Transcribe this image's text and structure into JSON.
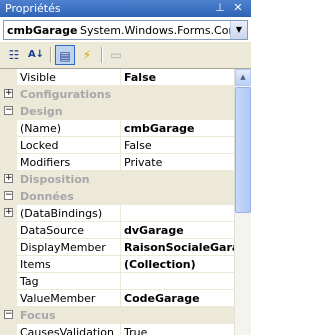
{
  "window": {
    "title": "Propriétés"
  },
  "object_selector": {
    "name": "cmbGarage",
    "type": "System.Windows.Forms.ComboBox"
  },
  "properties": [
    {
      "kind": "prop",
      "name": "Visible",
      "value": "False",
      "bold": true
    },
    {
      "kind": "cat",
      "name": "Configurations",
      "expander": "+"
    },
    {
      "kind": "cat",
      "name": "Design",
      "expander": "−"
    },
    {
      "kind": "prop",
      "name": "(Name)",
      "value": "cmbGarage",
      "bold": true
    },
    {
      "kind": "prop",
      "name": "Locked",
      "value": "False",
      "bold": false
    },
    {
      "kind": "prop",
      "name": "Modifiers",
      "value": "Private",
      "bold": false
    },
    {
      "kind": "cat",
      "name": "Disposition",
      "expander": "+"
    },
    {
      "kind": "cat",
      "name": "Données",
      "expander": "−"
    },
    {
      "kind": "prop",
      "name": "(DataBindings)",
      "value": "",
      "bold": false,
      "expander": "+"
    },
    {
      "kind": "prop",
      "name": "DataSource",
      "value": "dvGarage",
      "bold": true
    },
    {
      "kind": "prop",
      "name": "DisplayMember",
      "value": "RaisonSocialeGarage",
      "bold": true
    },
    {
      "kind": "prop",
      "name": "Items",
      "value": "(Collection)",
      "bold": true
    },
    {
      "kind": "prop",
      "name": "Tag",
      "value": "",
      "bold": false
    },
    {
      "kind": "prop",
      "name": "ValueMember",
      "value": "CodeGarage",
      "bold": true
    },
    {
      "kind": "cat",
      "name": "Focus",
      "expander": "−"
    },
    {
      "kind": "prop",
      "name": "CausesValidation",
      "value": "True",
      "bold": false
    }
  ]
}
